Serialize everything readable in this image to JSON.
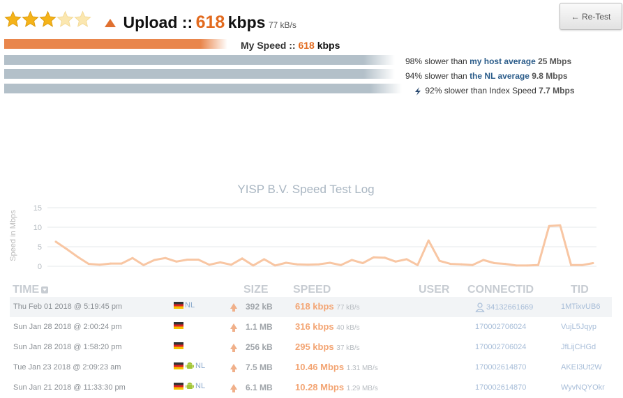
{
  "rating": {
    "stars_total": 5,
    "stars_filled": 3
  },
  "header": {
    "label": "Upload ::",
    "value": "618",
    "unit": "kbps",
    "kbs": "77 kB/s",
    "retest_label": "← Re-Test"
  },
  "my_speed": {
    "label": "My Speed ::",
    "value": "618",
    "unit": "kbps",
    "fraction": 0.55
  },
  "comparisons": [
    {
      "prefix": "98% slower than",
      "link": "my host average",
      "value": "25 Mbps",
      "fraction": 1.0
    },
    {
      "prefix": "94% slower than",
      "link": "the NL average",
      "value": "9.8 Mbps",
      "fraction": 1.0
    },
    {
      "prefix": "92% slower than Index Speed",
      "link": "",
      "value": "7.7 Mbps",
      "fraction": 1.0
    }
  ],
  "chart_data": {
    "type": "line",
    "title": "YISP B.V. Speed Test Log",
    "ylabel": "Speed in Mbps",
    "xlabel": "",
    "ylim": [
      0,
      15
    ],
    "yticks": [
      0,
      5,
      10,
      15
    ],
    "grid": true,
    "color": "#f8c6a3",
    "values": [
      6.3,
      4.4,
      2.4,
      0.6,
      0.4,
      0.7,
      0.7,
      2.1,
      0.3,
      1.6,
      2.1,
      1.2,
      1.7,
      1.7,
      0.4,
      1.0,
      0.4,
      2.0,
      0.2,
      1.8,
      0.2,
      0.9,
      0.5,
      0.4,
      0.5,
      0.9,
      0.3,
      1.6,
      0.8,
      2.3,
      2.2,
      1.2,
      1.8,
      0.3,
      6.6,
      1.4,
      0.6,
      0.5,
      0.3,
      1.6,
      0.8,
      0.6,
      0.2,
      0.2,
      0.3,
      10.3,
      10.5,
      0.3,
      0.3,
      0.8
    ]
  },
  "table": {
    "headers": {
      "time": "TIME",
      "size": "SIZE",
      "speed": "SPEED",
      "user": "USER",
      "connect": "CONNECTID",
      "tid": "TID"
    },
    "rows": [
      {
        "time": "Thu Feb 01 2018 @ 5:19:45 pm",
        "country": "NL",
        "android": false,
        "size": "392 kB",
        "speed": "618 kbps",
        "sub": "77 kB/s",
        "user_icon": true,
        "connect": "34132661669",
        "tid": "1MTixvUB6"
      },
      {
        "time": "Sun Jan 28 2018 @ 2:00:24 pm",
        "country": "",
        "android": false,
        "size": "1.1 MB",
        "speed": "316 kbps",
        "sub": "40 kB/s",
        "user_icon": false,
        "connect": "170002706024",
        "tid": "VujL5Jqyp"
      },
      {
        "time": "Sun Jan 28 2018 @ 1:58:20 pm",
        "country": "",
        "android": false,
        "size": "256 kB",
        "speed": "295 kbps",
        "sub": "37 kB/s",
        "user_icon": false,
        "connect": "170002706024",
        "tid": "JfLijCHGd"
      },
      {
        "time": "Tue Jan 23 2018 @ 2:09:23 am",
        "country": "NL",
        "android": true,
        "size": "7.5 MB",
        "speed": "10.46 Mbps",
        "sub": "1.31 MB/s",
        "user_icon": false,
        "connect": "170002614870",
        "tid": "AKEI3Ut2W"
      },
      {
        "time": "Sun Jan 21 2018 @ 11:33:30 pm",
        "country": "NL",
        "android": true,
        "size": "6.1 MB",
        "speed": "10.28 Mbps",
        "sub": "1.29 MB/s",
        "user_icon": false,
        "connect": "170002614870",
        "tid": "WyvNQYOkr"
      }
    ]
  }
}
